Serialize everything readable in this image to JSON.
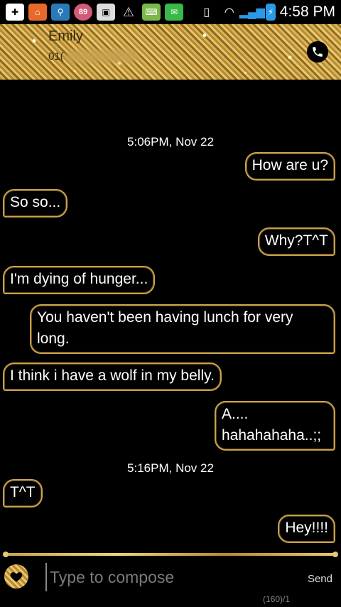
{
  "status_bar": {
    "notification_badge": "89",
    "time": "4:58 PM"
  },
  "header": {
    "contact_name": "Emily",
    "contact_number_prefix": "01("
  },
  "conversation": {
    "timestamps": [
      "5:06PM, Nov 22",
      "5:16PM, Nov 22"
    ],
    "messages": [
      {
        "dir": "out",
        "text": "How are u?"
      },
      {
        "dir": "in",
        "text": "So so..."
      },
      {
        "dir": "out",
        "text": "Why?T^T"
      },
      {
        "dir": "in",
        "text": "I'm dying of hunger..."
      },
      {
        "dir": "out",
        "text": "You haven't been having lunch for very long."
      },
      {
        "dir": "in",
        "text": "I think i have a wolf in my belly."
      },
      {
        "dir": "out",
        "text": "A.... hahahahaha..;;"
      },
      {
        "dir": "in",
        "text": "T^T"
      },
      {
        "dir": "out",
        "text": "Hey!!!!"
      }
    ]
  },
  "compose": {
    "placeholder": "Type to compose",
    "send_label": "Send",
    "counter": "(160)/1"
  },
  "colors": {
    "accent_gold": "#c9a24c",
    "background": "#000000"
  }
}
